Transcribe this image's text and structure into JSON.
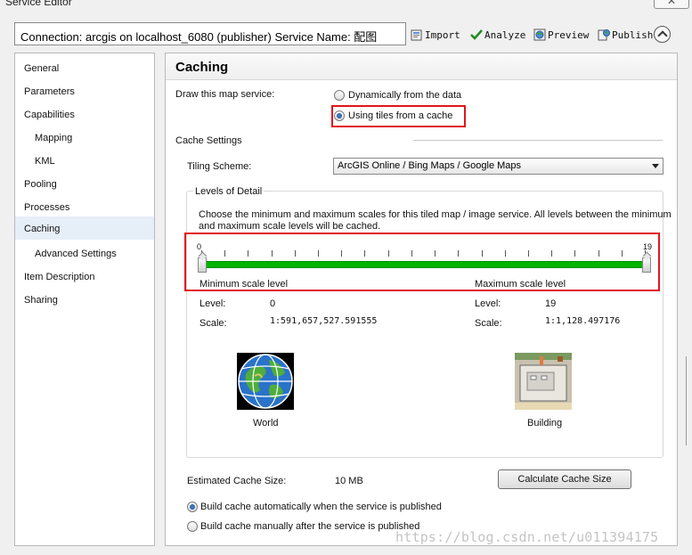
{
  "window": {
    "title": "Service Editor",
    "close_glyph": "✕"
  },
  "toolbar": {
    "connection_text": "Connection: arcgis on localhost_6080 (publisher)    Service Name: 配图",
    "import_label": "Import",
    "analyze_label": "Analyze",
    "preview_label": "Preview",
    "publish_label": "Publish"
  },
  "sidebar": {
    "items": [
      {
        "label": "General"
      },
      {
        "label": "Parameters"
      },
      {
        "label": "Capabilities"
      },
      {
        "label": "Mapping"
      },
      {
        "label": "KML"
      },
      {
        "label": "Pooling"
      },
      {
        "label": "Processes"
      },
      {
        "label": "Caching",
        "selected": true
      },
      {
        "label": "Advanced Settings"
      },
      {
        "label": "Item Description"
      },
      {
        "label": "Sharing"
      }
    ]
  },
  "caching": {
    "title": "Caching",
    "draw_label": "Draw this map service:",
    "option_dynamic": "Dynamically from the data",
    "option_tiles": "Using tiles from a cache",
    "selected_option": "tiles",
    "cache_settings_label": "Cache Settings",
    "tiling_scheme_label": "Tiling Scheme:",
    "tiling_scheme_value": "ArcGIS Online / Bing Maps / Google Maps",
    "levels_of_detail_label": "Levels of Detail",
    "lod_description_line1": "Choose the minimum and maximum scales for this tiled map / image service. All levels between the minimum",
    "lod_description_line2": "and maximum scale levels will be cached.",
    "slider": {
      "min": 0,
      "max": 19,
      "min_label": "0",
      "max_label": "19",
      "selected_min": 0,
      "selected_max": 19
    },
    "min_scale": {
      "heading": "Minimum scale level",
      "level_label": "Level:",
      "level_value": "0",
      "scale_label": "Scale:",
      "scale_value": "1:591,657,527.591555",
      "image_label": "World"
    },
    "max_scale": {
      "heading": "Maximum scale level",
      "level_label": "Level:",
      "level_value": "19",
      "scale_label": "Scale:",
      "scale_value": "1:1,128.497176",
      "image_label": "Building"
    },
    "estimated_size_label": "Estimated Cache Size:",
    "estimated_size_value": "10 MB",
    "calculate_button": "Calculate Cache Size",
    "build_auto_label": "Build cache automatically when the service is published",
    "build_manual_label": "Build cache manually after the service is published",
    "build_selected": "auto"
  },
  "watermark": "https://blog.csdn.net/u011394175",
  "colors": {
    "highlight_red": "#e0161b",
    "slider_green": "#00b400",
    "selected_nav": "#e6eef8"
  }
}
